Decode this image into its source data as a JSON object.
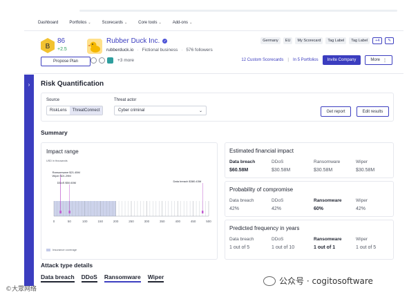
{
  "nav": {
    "items": [
      {
        "label": "Dashboard",
        "chevron": false
      },
      {
        "label": "Portfolios",
        "chevron": true
      },
      {
        "label": "Scorecards",
        "chevron": true
      },
      {
        "label": "Core tools",
        "chevron": true
      },
      {
        "label": "Add-ons",
        "chevron": true
      }
    ]
  },
  "header": {
    "grade": "B",
    "grade_color": "#f2c230",
    "score": "86",
    "delta": "+2.5",
    "propose_label": "Propose Plan",
    "company_name": "Rubber Duck Inc.",
    "verified_icon": "check",
    "url": "rubberduck.io",
    "separator": "·",
    "type": "Fictional business",
    "followers": "576 followers",
    "more": "+3 more",
    "tags": [
      "Germany",
      "EU",
      "My Scorecard",
      "Tag Label",
      "Tag Label"
    ],
    "tag_more": "+4",
    "custom_scorecards": "12 Custom Scorecards",
    "actions_separator": "|",
    "in_portfolios": "In 5 Portfolios",
    "invite_label": "Invite Company",
    "more_label": "More",
    "more_icon": "⋮",
    "edit_icon": "✎"
  },
  "page": {
    "title": "Risk Quantification",
    "collapse_icon": "›"
  },
  "filters": {
    "source_label": "Source",
    "source_options": [
      "RiskLens",
      "ThreatConnect"
    ],
    "source_selected": "ThreatConnect",
    "threat_label": "Threat actor",
    "threat_value": "Cyber criminal",
    "report_label": "Get report",
    "edit_label": "Edit results"
  },
  "summary": {
    "title": "Summary",
    "impact": {
      "title": "Impact range",
      "unit": "USD in thousands",
      "legend": "Insurance coverage"
    },
    "financial": {
      "title": "Estimated financial impact",
      "columns": [
        "Data breach",
        "DDoS",
        "Ransomware",
        "Wiper"
      ],
      "values": [
        "$60.58M",
        "$30.58M",
        "$30.58M",
        "$30.58M"
      ],
      "bold_index": 0
    },
    "probability": {
      "title": "Probability of compromise",
      "columns": [
        "Data breach",
        "DDoS",
        "Ransomware",
        "Wiper"
      ],
      "values": [
        "42%",
        "42%",
        "60%",
        "42%"
      ],
      "bold_index": 2
    },
    "frequency": {
      "title": "Predicted frequency in years",
      "columns": [
        "Data breach",
        "DDoS",
        "Ransomware",
        "Wiper"
      ],
      "values": [
        "1 out of 5",
        "1 out of 10",
        "1 out of 1",
        "1 out of 5"
      ],
      "bold_index": 2
    }
  },
  "attack": {
    "title": "Attack type details",
    "tabs": [
      "Data breach",
      "DDoS",
      "Ransomware",
      "Wiper"
    ],
    "selected": "Ransomware"
  },
  "watermarks": {
    "left": "©大眾网络",
    "right": "公众号 · cogitosoftware"
  },
  "colors": {
    "primary": "#3b3dbf",
    "marker": "#c05bd0",
    "coverage": "#c4cbe8",
    "positive": "#2a9d5a"
  },
  "chart_data": {
    "type": "scatter",
    "title": "Impact range",
    "xlabel": "",
    "ylabel": "USD in thousands",
    "xlim": [
      0,
      500
    ],
    "ticks": [
      0,
      50,
      100,
      150,
      200,
      250,
      300,
      350,
      400,
      450,
      500
    ],
    "coverage_range": [
      0,
      200
    ],
    "series": [
      {
        "name": "Ransomware",
        "label": "Ransomware $21.45M",
        "x": 21.45
      },
      {
        "name": "Wiper",
        "label": "Wiper $21.29M",
        "x": 21.29
      },
      {
        "name": "DDoS",
        "label": "DDoS $50.60M",
        "x": 50.6
      },
      {
        "name": "Data breach",
        "label": "Data breach $380.43M",
        "x": 480.43
      }
    ],
    "legend": [
      "Insurance coverage"
    ]
  }
}
